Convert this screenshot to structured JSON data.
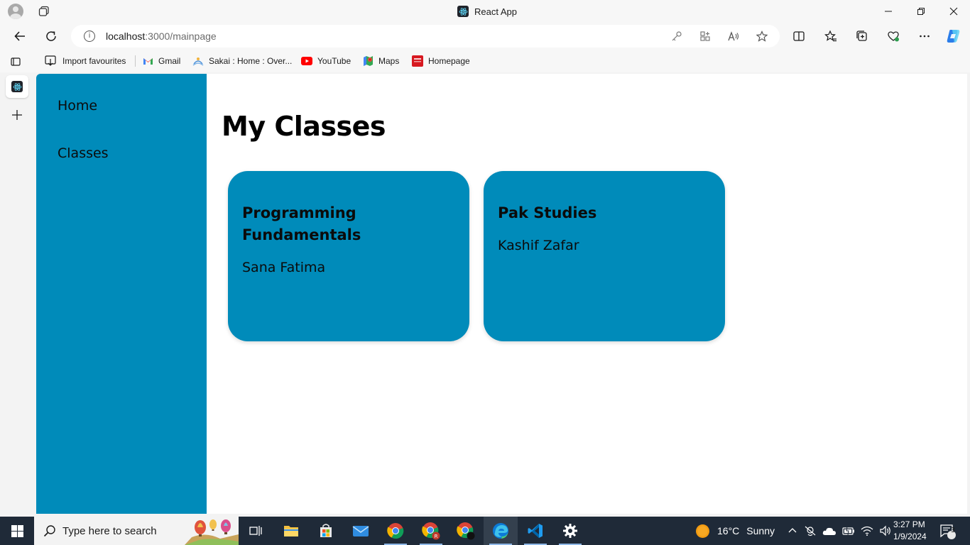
{
  "window": {
    "title": "React App"
  },
  "address_bar": {
    "host": "localhost",
    "path": ":3000/mainpage"
  },
  "favourites": [
    {
      "label": "Import favourites",
      "icon": "import-icon"
    },
    {
      "label": "Gmail",
      "icon": "gmail-icon"
    },
    {
      "label": "Sakai : Home : Over...",
      "icon": "sakai-icon"
    },
    {
      "label": "YouTube",
      "icon": "youtube-icon"
    },
    {
      "label": "Maps",
      "icon": "maps-icon"
    },
    {
      "label": "Homepage",
      "icon": "homepage-icon"
    }
  ],
  "sidebar": {
    "items": [
      {
        "label": "Home"
      },
      {
        "label": "Classes"
      }
    ]
  },
  "main": {
    "title": "My Classes",
    "classes": [
      {
        "name": "Programming Fundamentals",
        "teacher": "Sana Fatima"
      },
      {
        "name": "Pak Studies",
        "teacher": "Kashif Zafar"
      }
    ]
  },
  "taskbar": {
    "search_placeholder": "Type here to search",
    "weather": {
      "temp": "16°C",
      "condition": "Sunny"
    },
    "clock": {
      "time": "3:27 PM",
      "date": "1/9/2024"
    },
    "notification_count": "3"
  },
  "colors": {
    "accent": "#008bba",
    "taskbar": "#1f2a38"
  }
}
